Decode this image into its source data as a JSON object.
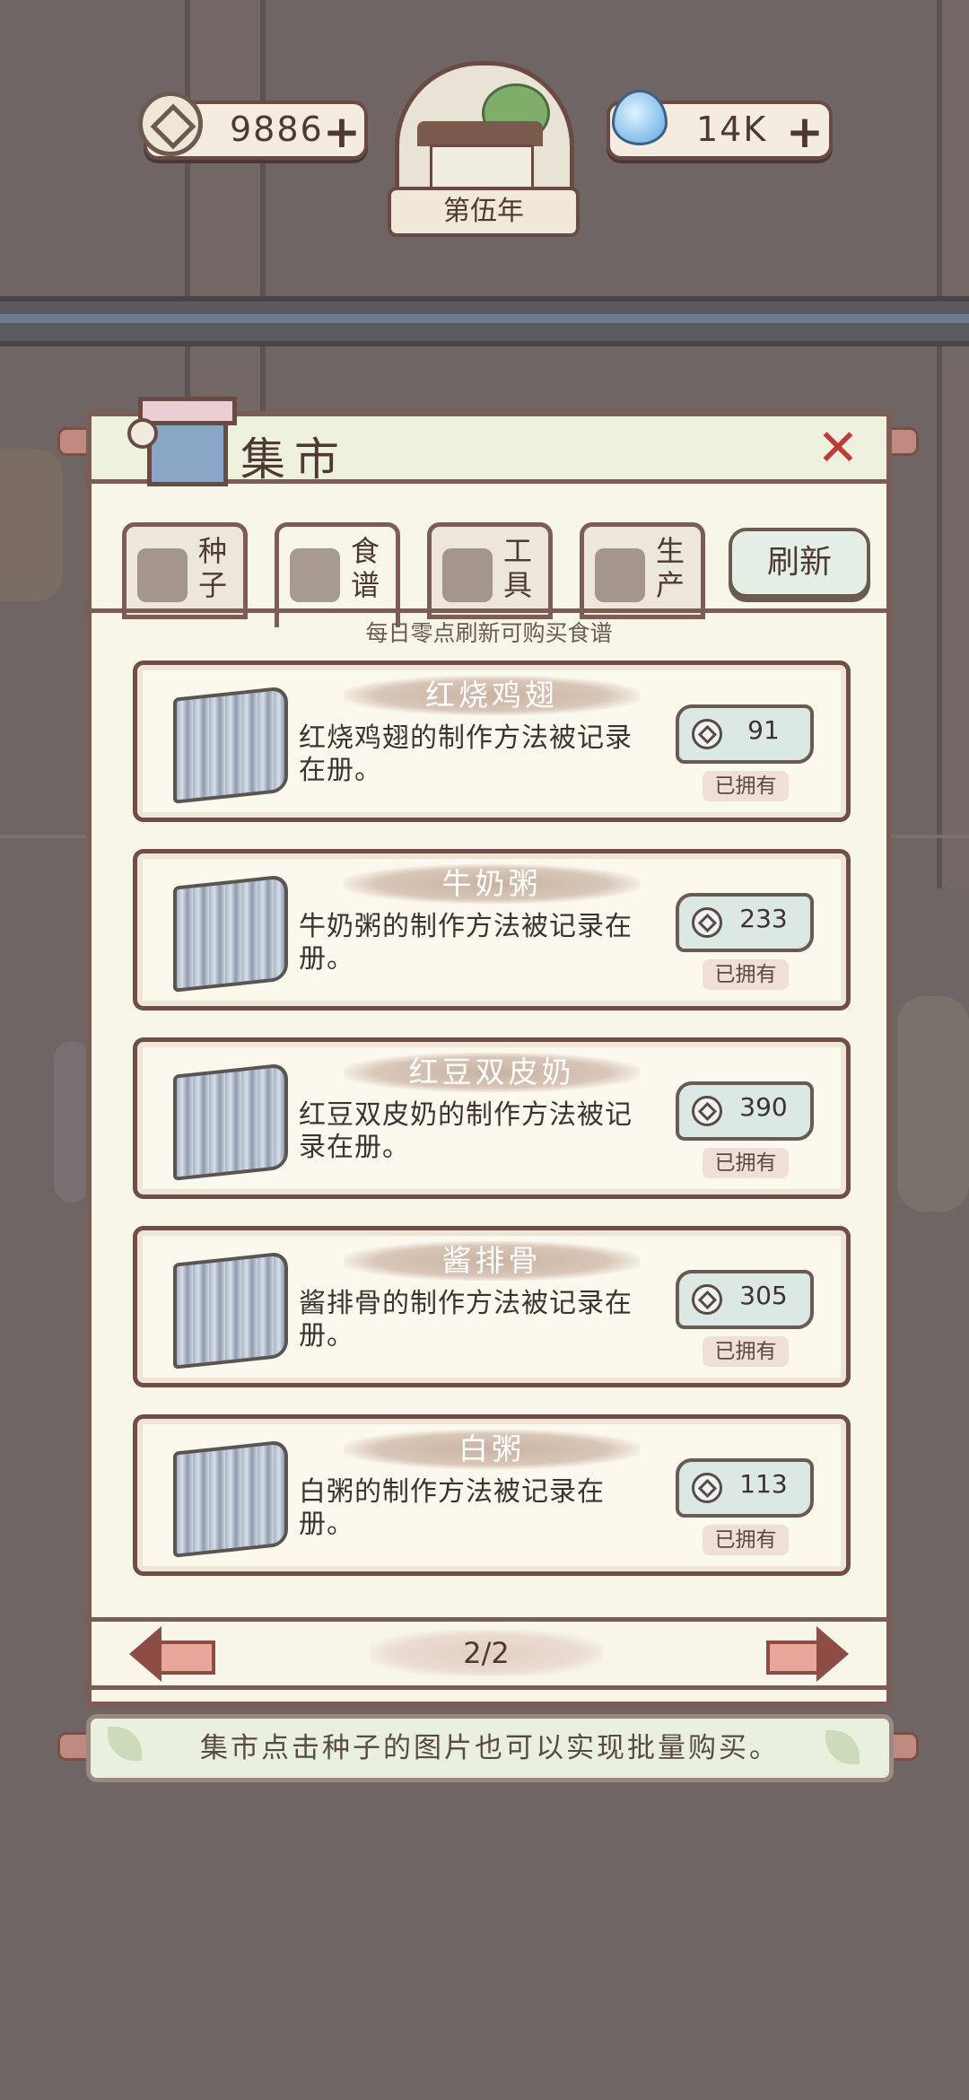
{
  "hud": {
    "coins": "9886",
    "coins_plus": "+",
    "water": "14K",
    "water_plus": "+",
    "year": "第伍年"
  },
  "market": {
    "title": "集市",
    "close": "✕",
    "tabs": [
      {
        "label_top": "种",
        "label_bottom": "子"
      },
      {
        "label_top": "食",
        "label_bottom": "谱"
      },
      {
        "label_top": "工",
        "label_bottom": "具"
      },
      {
        "label_top": "生",
        "label_bottom": "产"
      }
    ],
    "refresh": "刷新",
    "hint": "每日零点刷新可购买食谱",
    "recipes": [
      {
        "name": "红烧鸡翅",
        "desc": "红烧鸡翅的制作方法被记录在册。",
        "price": "91",
        "status": "已拥有"
      },
      {
        "name": "牛奶粥",
        "desc": "牛奶粥的制作方法被记录在册。",
        "price": "233",
        "status": "已拥有"
      },
      {
        "name": "红豆双皮奶",
        "desc": "红豆双皮奶的制作方法被记录在册。",
        "price": "390",
        "status": "已拥有"
      },
      {
        "name": "酱排骨",
        "desc": "酱排骨的制作方法被记录在册。",
        "price": "305",
        "status": "已拥有"
      },
      {
        "name": "白粥",
        "desc": "白粥的制作方法被记录在册。",
        "price": "113",
        "status": "已拥有"
      }
    ],
    "page": "2/2",
    "tip": "集市点击种子的图片也可以实现批量购买。"
  },
  "colors": {
    "background": "#6e6564",
    "panel": "#f8f5e9",
    "border": "#7c5d55",
    "close_red": "#c23a38",
    "text_dark": "#4e3a33"
  }
}
